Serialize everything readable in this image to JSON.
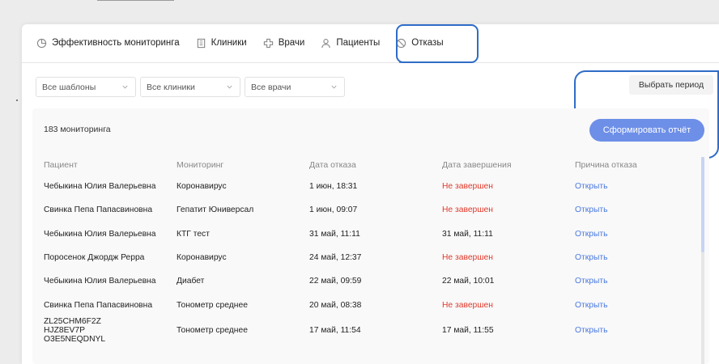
{
  "tabs": [
    {
      "label": "Эффективность мониторинга",
      "icon": "chart-icon"
    },
    {
      "label": "Клиники",
      "icon": "building-icon"
    },
    {
      "label": "Врачи",
      "icon": "medical-cross-icon"
    },
    {
      "label": "Пациенты",
      "icon": "person-icon"
    },
    {
      "label": "Отказы",
      "icon": "ban-icon",
      "active": true
    }
  ],
  "filters": {
    "template": "Все шаблоны",
    "clinic": "Все клиники",
    "doctor": "Все врачи"
  },
  "period_button": "Выбрать период",
  "report_button": "Сформировать отчёт",
  "count_label": "183 мониторинга",
  "columns": [
    "Пациент",
    "Мониторинг",
    "Дата отказа",
    "Дата завершения",
    "Причина отказа"
  ],
  "rows": [
    {
      "patient": "Чебыкина Юлия Валерьевна",
      "monitoring": "Коронавирус",
      "refusal_date": "1 июн, 18:31",
      "completion": "Не завершен",
      "reason": "Открыть"
    },
    {
      "patient": "Свинка Пепа Папасвиновна",
      "monitoring": "Гепатит Юниверсал",
      "refusal_date": "1 июн, 09:07",
      "completion": "Не завершен",
      "reason": "Открыть"
    },
    {
      "patient": "Чебыкина Юлия Валерьевна",
      "monitoring": "КТГ тест",
      "refusal_date": "31 май, 11:11",
      "completion": "31 май, 11:11",
      "reason": "Открыть"
    },
    {
      "patient": "Поросенок Джордж Рерра",
      "monitoring": "Коронавирус",
      "refusal_date": "24 май, 12:37",
      "completion": "Не завершен",
      "reason": "Открыть"
    },
    {
      "patient": "Чебыкина Юлия Валерьевна",
      "monitoring": "Диабет",
      "refusal_date": "22 май, 09:59",
      "completion": "22 май, 10:01",
      "reason": "Открыть"
    },
    {
      "patient": "Свинка Пепа Папасвиновна",
      "monitoring": "Тонометр среднее",
      "refusal_date": "20 май, 08:38",
      "completion": "Не завершен",
      "reason": "Открыть"
    },
    {
      "patient": "ZL25CHM6F2Z HJZ8EV7P O3E5NEQDNYL",
      "monitoring": "Тонометр среднее",
      "refusal_date": "17 май, 11:54",
      "completion": "17 май, 11:55",
      "reason": "Открыть"
    }
  ],
  "colors": {
    "accent": "#6d8fe8",
    "link": "#4a79e0",
    "not_completed": "#e0392b",
    "annotation": "#2f6cc7"
  }
}
